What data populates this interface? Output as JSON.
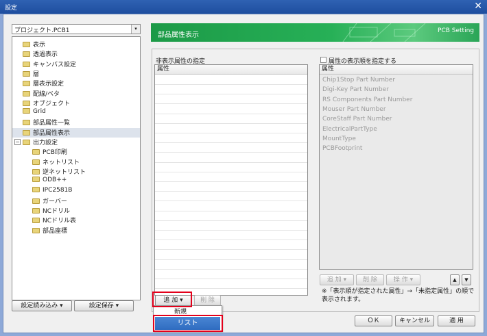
{
  "window": {
    "title": "設定",
    "close_glyph": "✕"
  },
  "project": {
    "selected": "プロジェクト.PCB1",
    "arrow": "▾"
  },
  "tree": {
    "items": [
      {
        "label": "表示"
      },
      {
        "label": "透過表示"
      },
      {
        "label": "キャンバス設定"
      },
      {
        "label": "層"
      },
      {
        "label": "層表示設定"
      },
      {
        "label": "配線/ベタ"
      },
      {
        "label": "オブジェクト"
      },
      {
        "label": "Grid"
      },
      {
        "label": "部品属性一覧"
      },
      {
        "label": "部品属性表示",
        "selected": true
      },
      {
        "label": "出力設定",
        "expander": "−"
      },
      {
        "label": "PCB印刷"
      },
      {
        "label": "ネットリスト"
      },
      {
        "label": "逆ネットリスト"
      },
      {
        "label": "ODB++"
      },
      {
        "label": "IPC2581B"
      },
      {
        "label": "ガーバー"
      },
      {
        "label": "NCドリル"
      },
      {
        "label": "NCドリル表"
      },
      {
        "label": "部品座標"
      }
    ]
  },
  "left_buttons": {
    "load": "設定読み込み ▾",
    "save": "設定保存 ▾"
  },
  "banner": {
    "title": "部品属性表示",
    "right": "PCB Setting"
  },
  "hidden": {
    "title": "非表示属性の指定",
    "header": "属性"
  },
  "display_order": {
    "checkbox_label": "属性の表示順を指定する",
    "header": "属性",
    "rows": [
      "Chip1Stop Part Number",
      "Digi-Key Part Number",
      "RS Components Part Number",
      "Mouser Part Number",
      "CoreStaff Part Number",
      "ElectricalPartType",
      "MountType",
      "PCBFootprint"
    ]
  },
  "right_tools": {
    "add": "追 加 ▾",
    "delete": "削 除",
    "operate": "操 作 ▾",
    "up": "▲",
    "down": "▼"
  },
  "note": "※「表示順が指定された属性」→「未指定属性」の順で表示されます。",
  "left_tools": {
    "add": "追 加 ▾",
    "delete": "削 除"
  },
  "dropdown": {
    "new": "新規",
    "list": "リスト"
  },
  "footer": {
    "ok": "ＯＫ",
    "cancel": "キャンセル",
    "apply": "適 用"
  },
  "colors": {
    "accent_red": "#e3001b",
    "banner_green": "#27b057",
    "title_blue": "#2f62b3"
  }
}
